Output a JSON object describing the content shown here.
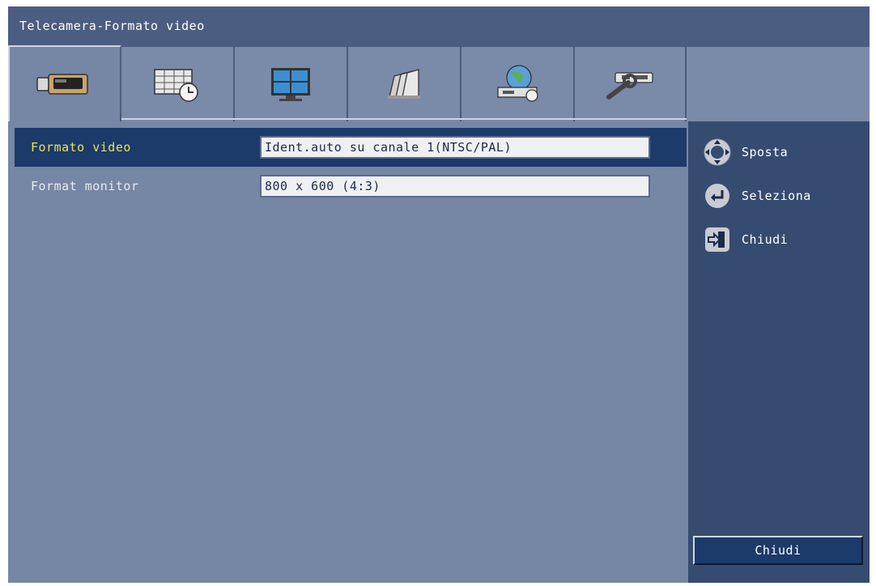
{
  "window": {
    "title": "Telecamera-Formato video"
  },
  "tabs": [
    {
      "icon": "camera-icon",
      "active": true
    },
    {
      "icon": "schedule-icon",
      "active": false
    },
    {
      "icon": "monitor-icon",
      "active": false
    },
    {
      "icon": "archive-icon",
      "active": false
    },
    {
      "icon": "network-icon",
      "active": false
    },
    {
      "icon": "tools-icon",
      "active": false
    }
  ],
  "settings": [
    {
      "label": "Formato video",
      "value": "Ident.auto su canale 1(NTSC/PAL)",
      "selected": true
    },
    {
      "label": "Format monitor",
      "value": "800 x 600 (4:3)",
      "selected": false
    }
  ],
  "help": [
    {
      "icon": "move-arrows-icon",
      "label": "Sposta"
    },
    {
      "icon": "enter-icon",
      "label": "Seleziona"
    },
    {
      "icon": "exit-icon",
      "label": "Chiudi"
    }
  ],
  "close_button": {
    "label": "Chiudi"
  },
  "colors": {
    "background": "#7686a5",
    "title_bar": "#4b5d80",
    "sidebar": "#354c70",
    "selection": "#1c3a6a",
    "selected_text": "#e8e35a"
  }
}
